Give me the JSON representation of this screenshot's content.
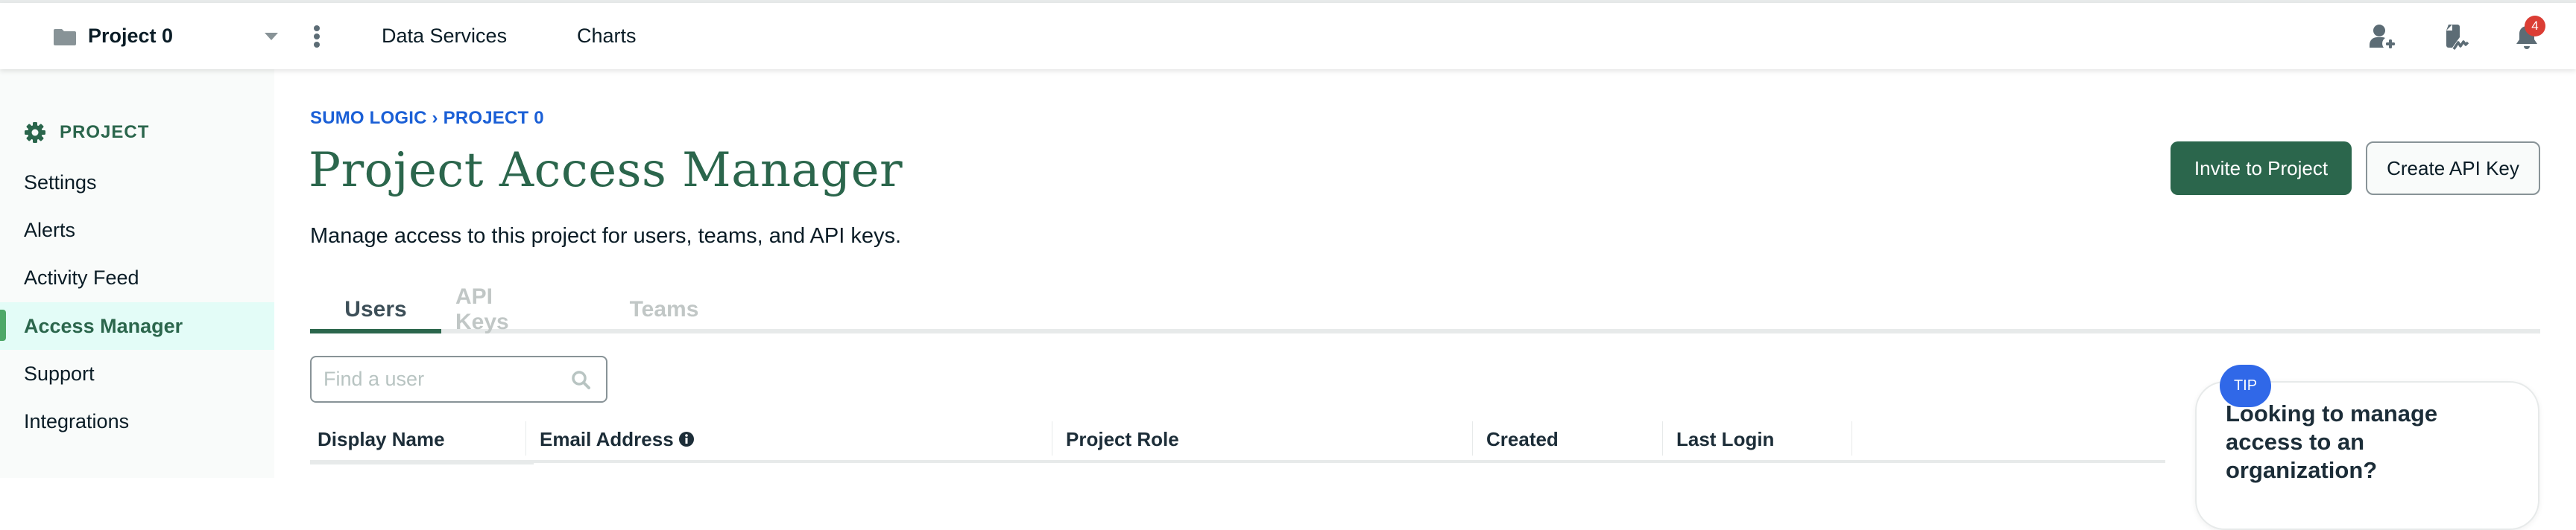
{
  "topnav": {
    "project_name": "Project 0",
    "links": [
      "Data Services",
      "Charts"
    ],
    "icons": [
      "user-plus-icon",
      "document-signature-icon",
      "bell-icon"
    ],
    "notification_count": "4"
  },
  "sidebar": {
    "heading": "PROJECT",
    "heading_icon": "gear-icon",
    "items": [
      {
        "label": "Settings",
        "active": false
      },
      {
        "label": "Alerts",
        "active": false
      },
      {
        "label": "Activity Feed",
        "active": false
      },
      {
        "label": "Access Manager",
        "active": true
      },
      {
        "label": "Support",
        "active": false
      },
      {
        "label": "Integrations",
        "active": false
      }
    ]
  },
  "breadcrumb": {
    "items": [
      "SUMO LOGIC",
      "PROJECT 0"
    ],
    "separator": "›"
  },
  "page": {
    "title": "Project Access Manager",
    "description": "Manage access to this project for users, teams, and API keys."
  },
  "actions": {
    "invite_label": "Invite to Project",
    "create_api_key_label": "Create API Key"
  },
  "tabs": [
    {
      "label": "Users",
      "active": true
    },
    {
      "label": "API Keys",
      "active": false
    },
    {
      "label": "Teams",
      "active": false
    }
  ],
  "search": {
    "placeholder": "Find a user",
    "value": ""
  },
  "table": {
    "columns": [
      "Display Name",
      "Email Address",
      "Project Role",
      "Created",
      "Last Login"
    ]
  },
  "tip": {
    "badge": "TIP",
    "text": "Looking to manage access to an organization?"
  },
  "colors": {
    "brand_green": "#2b664c",
    "active_indicator": "#4ea868",
    "link_blue": "#1a5fd6",
    "tip_blue": "#3068e8",
    "badge_red": "#db3d34"
  }
}
